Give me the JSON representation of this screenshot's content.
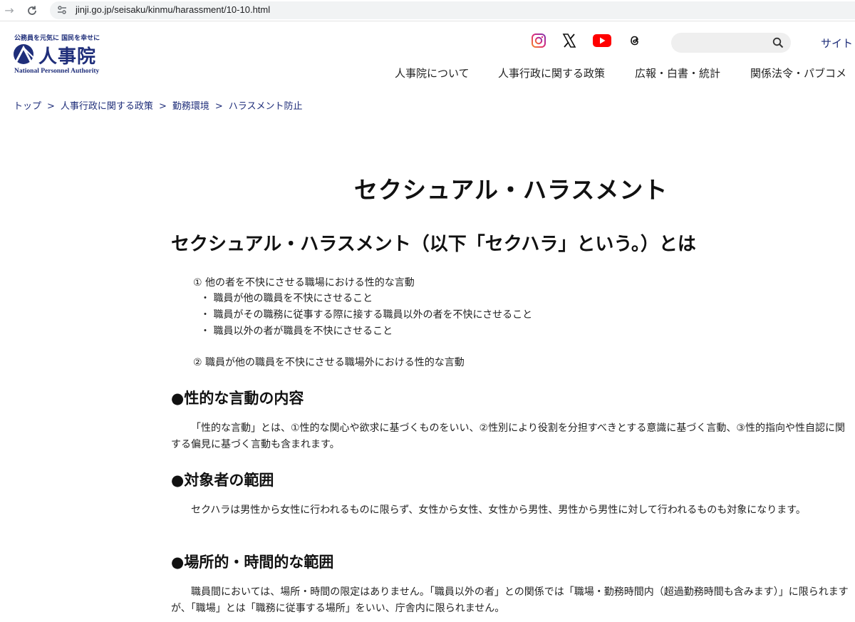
{
  "browser": {
    "url": "jinji.go.jp/seisaku/kinmu/harassment/10-10.html"
  },
  "header": {
    "tagline": "公務員を元気に 国民を幸せに",
    "logo_name": "人事院",
    "logo_en": "National Personnel Authority",
    "brand_color": "#1f2e7a",
    "social": [
      "instagram-icon",
      "x-icon",
      "youtube-icon",
      "threads-icon"
    ],
    "search": {
      "placeholder": ""
    },
    "sitemap_label": "サイト",
    "nav": [
      {
        "label": "人事院について"
      },
      {
        "label": "人事行政に関する政策"
      },
      {
        "label": "広報・白書・統計"
      },
      {
        "label": "関係法令・パブコメ"
      }
    ]
  },
  "breadcrumb": [
    {
      "label": "トップ"
    },
    {
      "label": "人事行政に関する政策"
    },
    {
      "label": "勤務環境"
    },
    {
      "label": "ハラスメント防止"
    }
  ],
  "main": {
    "title": "セクシュアル・ハラスメント",
    "definition_heading": "セクシュアル・ハラスメント（以下「セクハラ」という。）とは",
    "definitions": [
      "① 他の者を不快にさせる職場における性的な言動",
      "・ 職員が他の職員を不快にさせること",
      "・ 職員がその職務に従事する際に接する職員以外の者を不快にさせること",
      "・ 職員以外の者が職員を不快にさせること",
      "② 職員が他の職員を不快にさせる職場外における性的な言動"
    ],
    "sections": [
      {
        "heading": "●性的な言動の内容",
        "body": "「性的な言動」とは、①性的な関心や欲求に基づくものをいい、②性別により役割を分担すべきとする意識に基づく言動、③性的指向や性自認に関する偏見に基づく言動も含まれます。"
      },
      {
        "heading": "●対象者の範囲",
        "body": "セクハラは男性から女性に行われるものに限らず、女性から女性、女性から男性、男性から男性に対して行われるものも対象になります。"
      },
      {
        "heading": "●場所的・時間的な範囲",
        "body": "職員間においては、場所・時間の限定はありません。「職員以外の者」との関係では「職場・勤務時間内（超過勤務時間も含みます）」に限られますが、「職場」とは「職務に従事する場所」をいい、庁舎内に限られません。"
      }
    ]
  }
}
